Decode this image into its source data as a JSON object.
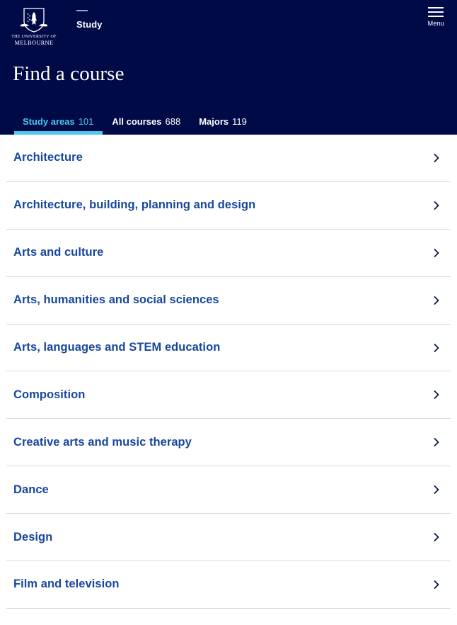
{
  "header": {
    "brand": {
      "icon": "university-crest-icon",
      "line1": "THE UNIVERSITY OF",
      "line2": "MELBOURNE"
    },
    "section_label": "Study",
    "menu": {
      "icon": "hamburger-menu-icon",
      "label": "Menu"
    },
    "title": "Find a course",
    "colors": {
      "background": "#000a47",
      "accent": "#4ec7f0",
      "link": "#17479e"
    }
  },
  "tabs": [
    {
      "label": "Study areas",
      "count": "101",
      "active": true
    },
    {
      "label": "All courses",
      "count": "688",
      "active": false
    },
    {
      "label": "Majors",
      "count": "119",
      "active": false
    }
  ],
  "list": {
    "items": [
      {
        "label": "Architecture",
        "icon": "chevron-right-icon"
      },
      {
        "label": "Architecture, building, planning and design",
        "icon": "chevron-right-icon"
      },
      {
        "label": "Arts and culture",
        "icon": "chevron-right-icon"
      },
      {
        "label": "Arts, humanities and social sciences",
        "icon": "chevron-right-icon"
      },
      {
        "label": "Arts, languages and STEM education",
        "icon": "chevron-right-icon"
      },
      {
        "label": "Composition",
        "icon": "chevron-right-icon"
      },
      {
        "label": "Creative arts and music therapy",
        "icon": "chevron-right-icon"
      },
      {
        "label": "Dance",
        "icon": "chevron-right-icon"
      },
      {
        "label": "Design",
        "icon": "chevron-right-icon"
      },
      {
        "label": "Film and television",
        "icon": "chevron-right-icon"
      }
    ]
  }
}
